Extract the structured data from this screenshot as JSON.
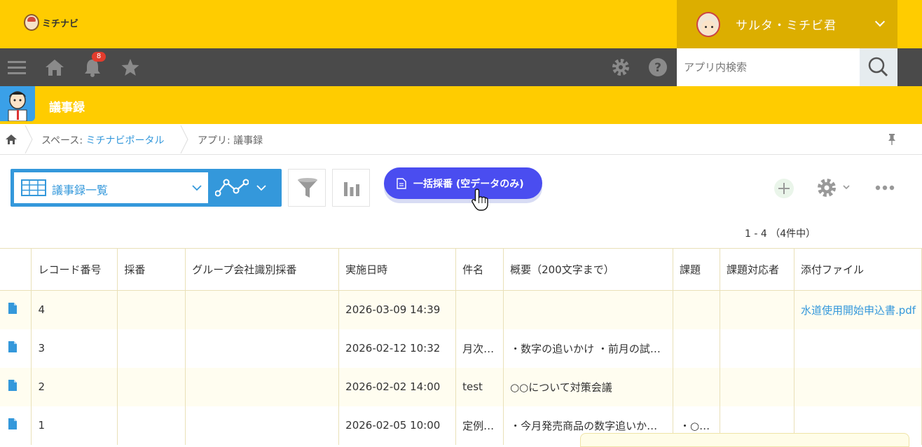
{
  "header": {
    "logo_text": "ミチナビ",
    "user_name": "サルタ・ミチビ君"
  },
  "navbar": {
    "notification_count": "8",
    "search_placeholder": "アプリ内検索",
    "icons": [
      "menu-icon",
      "home-icon",
      "bell-icon",
      "star-icon",
      "gear-icon",
      "help-icon",
      "search-icon"
    ]
  },
  "app": {
    "title": "議事録"
  },
  "breadcrumb": {
    "space_prefix": "スペース: ",
    "space_name": "ミチナビポータル",
    "app_crumb": "アプリ: 議事録"
  },
  "toolbar": {
    "view_name": "議事録一覧",
    "bulk_button_label": "一括採番 (空データのみ)",
    "record_count": "1 - 4 （4件中）"
  },
  "colors": {
    "brand_yellow": "#ffcc00",
    "nav_dark": "#4a4a4a",
    "accent_blue": "#3498db",
    "bulk_button": "#4a4df0"
  },
  "table": {
    "headers": [
      "レコード番号",
      "採番",
      "グループ会社識別採番",
      "実施日時",
      "件名",
      "概要（200文字まで）",
      "課題",
      "課題対応者",
      "添付ファイル"
    ],
    "rows": [
      {
        "no": "4",
        "saiban": "",
        "group": "",
        "date": "2026-03-09 14:39",
        "subject": "",
        "summary": "",
        "issue": "",
        "assignee": "",
        "file": "水道使用開始申込書.pdf"
      },
      {
        "no": "3",
        "saiban": "",
        "group": "",
        "date": "2026-02-12 10:32",
        "subject": "月次…",
        "summary": "・数字の追いかけ ・前月の試…",
        "issue": "",
        "assignee": "",
        "file": ""
      },
      {
        "no": "2",
        "saiban": "",
        "group": "",
        "date": "2026-02-02 14:00",
        "subject": "test",
        "summary": "○○について対策会議",
        "issue": "",
        "assignee": "",
        "file": ""
      },
      {
        "no": "1",
        "saiban": "",
        "group": "",
        "date": "2026-02-05 10:00",
        "subject": "定例…",
        "summary": "・今月発売商品の数字追いか…",
        "issue": "・○…",
        "assignee": "",
        "file": ""
      }
    ]
  }
}
